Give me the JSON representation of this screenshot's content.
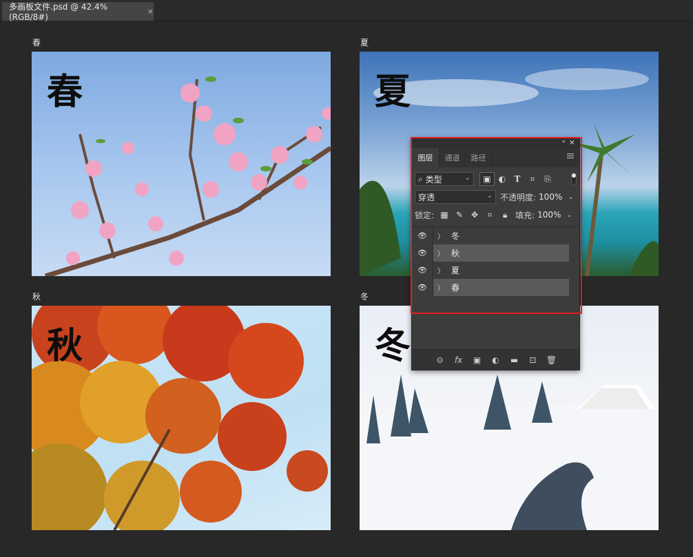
{
  "document_tab": {
    "title": "多画板文件.psd @ 42.4%(RGB/8#)",
    "close": "×"
  },
  "artboards": [
    {
      "label": "春",
      "text": "春"
    },
    {
      "label": "夏",
      "text": "夏"
    },
    {
      "label": "秋",
      "text": "秋"
    },
    {
      "label": "冬",
      "text": "冬"
    }
  ],
  "layers_panel": {
    "collapse": "«",
    "close": "×",
    "tabs": [
      "图层",
      "通道",
      "路径"
    ],
    "filter": {
      "value": "类型",
      "search_icon": "⌕"
    },
    "blend_mode": "穿透",
    "opacity": {
      "label": "不透明度:",
      "value": "100%"
    },
    "lock": {
      "label": "锁定:"
    },
    "fill": {
      "label": "填充:",
      "value": "100%"
    },
    "layers": [
      "冬",
      "秋",
      "夏",
      "春"
    ],
    "bottom_icons": {
      "link": "⊝",
      "fx": "fx",
      "mask": "▣",
      "adjustment": "◐",
      "group": "▬",
      "new": "⊡",
      "delete": "🗑"
    }
  },
  "colors": {
    "accent_highlight": "#e32020",
    "panel_bg": "#3c3c3c",
    "canvas_bg": "#282828"
  }
}
